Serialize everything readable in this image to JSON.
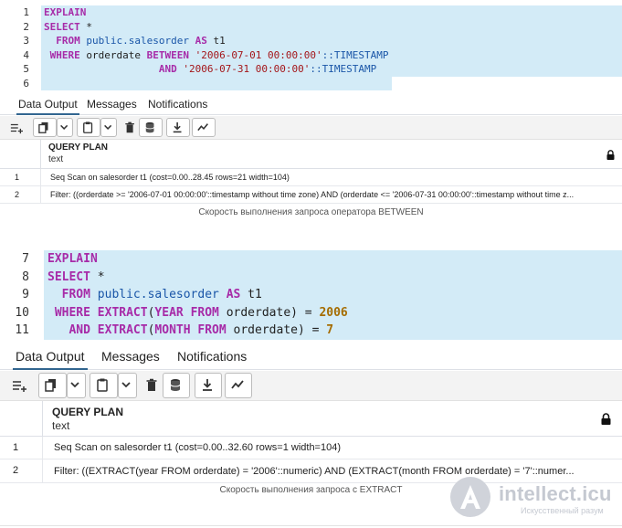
{
  "panel1": {
    "code": [
      {
        "num": "1",
        "tokens": [
          {
            "t": "EXPLAIN",
            "c": "kw"
          }
        ]
      },
      {
        "num": "2",
        "tokens": [
          {
            "t": "SELECT",
            "c": "kw"
          },
          {
            "t": " *",
            "c": "pl"
          }
        ]
      },
      {
        "num": "3",
        "tokens": [
          {
            "t": "  FROM ",
            "c": "kw"
          },
          {
            "t": "public",
            "c": "obj"
          },
          {
            "t": ".salesorder ",
            "c": "obj"
          },
          {
            "t": "AS",
            "c": "kw"
          },
          {
            "t": " t1",
            "c": "pl"
          }
        ]
      },
      {
        "num": "4",
        "tokens": [
          {
            "t": " WHERE ",
            "c": "kw"
          },
          {
            "t": "orderdate ",
            "c": "pl"
          },
          {
            "t": "BETWEEN ",
            "c": "kw"
          },
          {
            "t": "'2006-07-01 00:00:00'",
            "c": "str"
          },
          {
            "t": "::TIMESTAMP",
            "c": "obj"
          }
        ]
      },
      {
        "num": "5",
        "tokens": [
          {
            "t": "                   AND ",
            "c": "kw"
          },
          {
            "t": "'2006-07-31 00:00:00'",
            "c": "str"
          },
          {
            "t": "::TIMESTAMP",
            "c": "obj"
          }
        ]
      },
      {
        "num": "6",
        "tokens": []
      }
    ],
    "tabs": [
      "Data Output",
      "Messages",
      "Notifications"
    ],
    "column_name": "QUERY PLAN",
    "column_type": "text",
    "rows": [
      {
        "num": "1",
        "text": "Seq Scan on salesorder t1  (cost=0.00..28.45 rows=21 width=104)"
      },
      {
        "num": "2",
        "text": "  Filter: ((orderdate >= '2006-07-01 00:00:00'::timestamp without time zone) AND (orderdate <= '2006-07-31 00:00:00'::timestamp without time z..."
      }
    ],
    "caption": "Скорость выполнения запроса оператора BETWEEN"
  },
  "panel2": {
    "code": [
      {
        "num": "7",
        "tokens": [
          {
            "t": "EXPLAIN",
            "c": "kw"
          }
        ]
      },
      {
        "num": "8",
        "tokens": [
          {
            "t": "SELECT",
            "c": "kw"
          },
          {
            "t": " *",
            "c": "pl"
          }
        ]
      },
      {
        "num": "9",
        "tokens": [
          {
            "t": "  FROM ",
            "c": "kw"
          },
          {
            "t": "public",
            "c": "obj"
          },
          {
            "t": ".salesorder ",
            "c": "obj"
          },
          {
            "t": "AS",
            "c": "kw"
          },
          {
            "t": " t1",
            "c": "pl"
          }
        ]
      },
      {
        "num": "10",
        "tokens": [
          {
            "t": " WHERE ",
            "c": "kw"
          },
          {
            "t": "EXTRACT",
            "c": "kw"
          },
          {
            "t": "(",
            "c": "pl"
          },
          {
            "t": "YEAR ",
            "c": "kw"
          },
          {
            "t": "FROM ",
            "c": "kw"
          },
          {
            "t": "orderdate) = ",
            "c": "pl"
          },
          {
            "t": "2006",
            "c": "num"
          }
        ]
      },
      {
        "num": "11",
        "tokens": [
          {
            "t": "   AND ",
            "c": "kw"
          },
          {
            "t": "EXTRACT",
            "c": "kw"
          },
          {
            "t": "(",
            "c": "pl"
          },
          {
            "t": "MONTH ",
            "c": "kw"
          },
          {
            "t": "FROM ",
            "c": "kw"
          },
          {
            "t": "orderdate) = ",
            "c": "pl"
          },
          {
            "t": "7",
            "c": "num"
          }
        ]
      }
    ],
    "tabs": [
      "Data Output",
      "Messages",
      "Notifications"
    ],
    "column_name": "QUERY PLAN",
    "column_type": "text",
    "rows": [
      {
        "num": "1",
        "text": "Seq Scan on salesorder t1  (cost=0.00..32.60 rows=1 width=104)"
      },
      {
        "num": "2",
        "text": "  Filter: ((EXTRACT(year FROM orderdate) = '2006'::numeric) AND (EXTRACT(month FROM orderdate) = '7'::numer..."
      }
    ],
    "caption": "Скорость выполнения запроса с EXTRACT"
  },
  "watermark": {
    "logo_letter": "A",
    "site": "intellect.icu",
    "sub": "Искусственный разум"
  },
  "colors": {
    "line_highlight": "#d3ebf7",
    "keyword": "#a72ba8",
    "string": "#a4161a",
    "number": "#a56c00",
    "identifier": "#1a56a8",
    "active_tab_underline": "#326690"
  }
}
